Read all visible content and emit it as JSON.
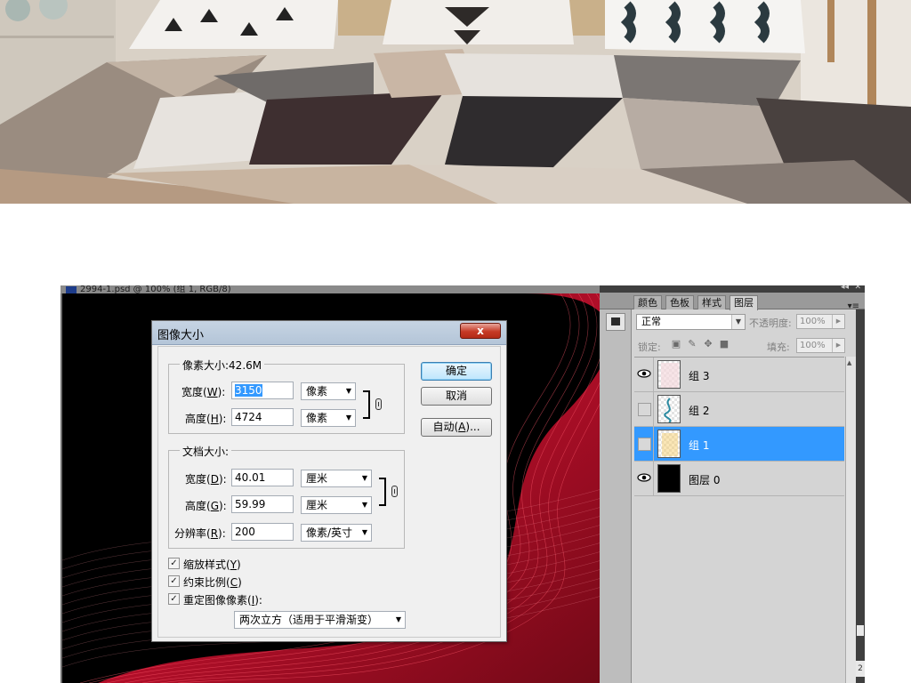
{
  "document": {
    "title": "2994-1.psd @ 100% (组 1, RGB/8)"
  },
  "layers_panel": {
    "tabs": [
      {
        "label": "颜色",
        "active": false
      },
      {
        "label": "色板",
        "active": false
      },
      {
        "label": "样式",
        "active": false
      },
      {
        "label": "图层",
        "active": true
      }
    ],
    "blend_mode": "正常",
    "opacity_label": "不透明度:",
    "opacity_value": "100%",
    "lock_label": "锁定:",
    "fill_label": "填充:",
    "fill_value": "100%",
    "layers": [
      {
        "name": "组 3",
        "visible": true,
        "selected": false
      },
      {
        "name": "组 2",
        "visible": false,
        "selected": false
      },
      {
        "name": "组 1",
        "visible": false,
        "selected": true
      },
      {
        "name": "图层 0",
        "visible": true,
        "selected": false
      }
    ],
    "edge_number": "2"
  },
  "dialog": {
    "title": "图像大小",
    "close_label": "x",
    "pixel_dimensions_legend": "像素大小:42.6M",
    "width_label": "宽度(",
    "width_key": "W",
    "height_label": "高度(",
    "height_key": "H",
    "pixel_width": "3150",
    "pixel_height": "4724",
    "pixel_unit": "像素",
    "document_size_legend": "文档大小:",
    "doc_width_key": "D",
    "doc_height_key": "G",
    "doc_width": "40.01",
    "doc_height": "59.99",
    "doc_unit": "厘米",
    "resolution_label": "分辨率(",
    "resolution_key": "R",
    "resolution": "200",
    "resolution_unit": "像素/英寸",
    "label_suffix": "):",
    "ok_label": "确定",
    "cancel_label": "取消",
    "auto_label": "自动(",
    "auto_key": "A",
    "auto_suffix": ")...",
    "scale_styles_label": "缩放样式(",
    "scale_styles_key": "Y",
    "constrain_label": "约束比例(",
    "constrain_key": "C",
    "resample_label": "重定图像像素(",
    "resample_key": "I",
    "close_paren": ")",
    "resample_suffix": "):",
    "scale_styles_checked": true,
    "constrain_checked": true,
    "resample_checked": true,
    "resample_method": "两次立方（适用于平滑渐变）"
  },
  "colors": {
    "selection_blue": "#3399ff",
    "dialog_bg": "#f0f0f0",
    "close_red": "#c63a26",
    "canvas_red": "#c8102e"
  }
}
